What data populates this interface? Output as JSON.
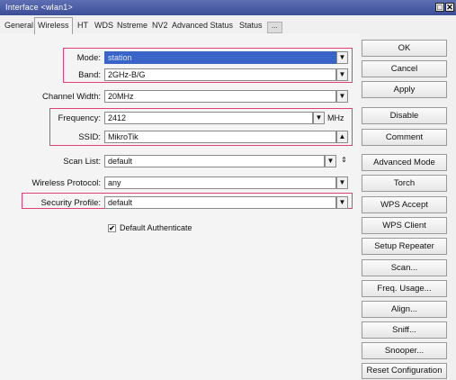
{
  "window": {
    "title": "Interface <wlan1>",
    "restore_icon": "□",
    "close_icon": "✕"
  },
  "tabs": [
    "General",
    "Wireless",
    "HT",
    "WDS",
    "Nstreme",
    "NV2",
    "Advanced Status",
    "Status",
    "..."
  ],
  "active_tab": "Wireless",
  "form": {
    "mode": {
      "label": "Mode:",
      "value": "station"
    },
    "band": {
      "label": "Band:",
      "value": "2GHz-B/G"
    },
    "channel_width": {
      "label": "Channel Width:",
      "value": "20MHz"
    },
    "frequency": {
      "label": "Frequency:",
      "value": "2412",
      "unit": "MHz"
    },
    "ssid": {
      "label": "SSID:",
      "value": "MikroTik"
    },
    "scan_list": {
      "label": "Scan List:",
      "value": "default"
    },
    "wireless_protocol": {
      "label": "Wireless Protocol:",
      "value": "any"
    },
    "security_profile": {
      "label": "Security Profile:",
      "value": "default"
    },
    "default_authenticate": {
      "label": "Default Authenticate",
      "checked": true
    }
  },
  "buttons": [
    "OK",
    "Cancel",
    "Apply",
    "Disable",
    "Comment",
    "Advanced Mode",
    "Torch",
    "WPS Accept",
    "WPS Client",
    "Setup Repeater",
    "Scan...",
    "Freq. Usage...",
    "Align...",
    "Sniff...",
    "Snooper...",
    "Reset Configuration"
  ],
  "glyphs": {
    "dropdown": "▼",
    "collapse": "▲",
    "updown": "⇕",
    "check": "✔"
  },
  "colors": {
    "titlebar": "#4a5ba6",
    "highlight": "#e0407a",
    "selection": "#3a64c8"
  }
}
